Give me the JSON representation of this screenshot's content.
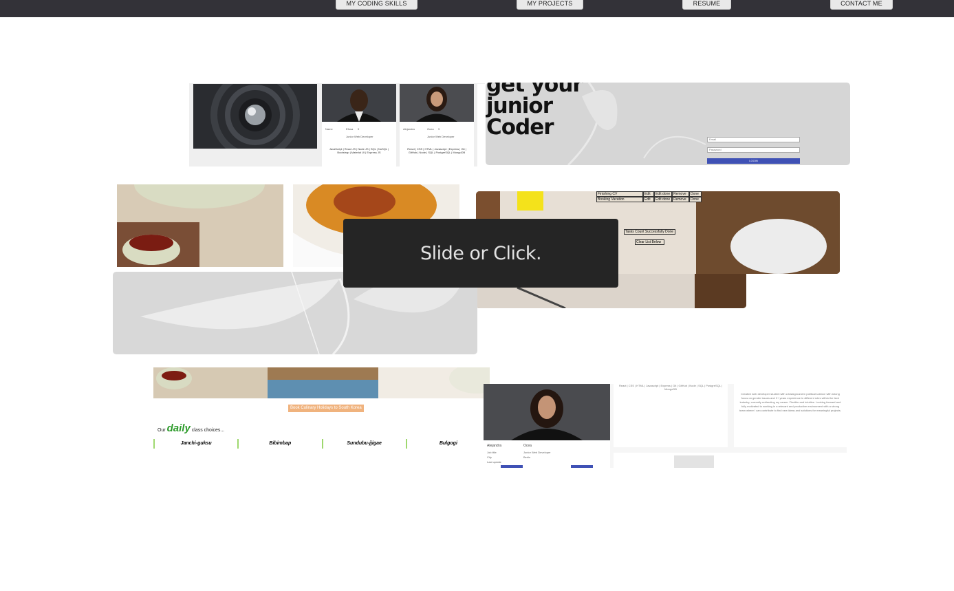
{
  "nav": {
    "items": [
      {
        "label": "MY CODING SKILLS"
      },
      {
        "label": "MY PROJECTS"
      },
      {
        "label": "RESUME"
      },
      {
        "label": "CONTACT ME"
      }
    ]
  },
  "overlay": {
    "text": "Slide or Click."
  },
  "tiles": {
    "dev_cards": {
      "cards": [
        {
          "name_left": "Name",
          "name_right": "Efosa",
          "title": "Junior Web Developer",
          "skills": "JavaScript | React JS | Node JS | SQL | NoSQL | Bootstrap | Material UI | Express JS"
        },
        {
          "name_left": "Alejandra",
          "name_right": "Ocea",
          "title": "Junior Web Developer",
          "skills": "React | CSS | HTML | Javascript | Express | Git | GitHub | Node | SQL | PostgreSQL | MongoDB"
        }
      ]
    },
    "junior_coder": {
      "headline": [
        "get your",
        "junior",
        "Coder"
      ],
      "email_placeholder": "Email",
      "password_placeholder": "Password",
      "login_label": "LOGIN"
    },
    "todo": {
      "rows": [
        {
          "task": "Finishing CV",
          "edit": "Edit",
          "edit_done": "Edit done",
          "remove": "Remove",
          "done": "Done"
        },
        {
          "task": "Booking Vacation",
          "edit": "Edit",
          "edit_done": "Edit done",
          "remove": "Remove",
          "done": "Done"
        }
      ],
      "count_button": "Tasks Count Successfully Done",
      "clear_button": "Clear List Below"
    },
    "culinary": {
      "banner": "Book Culinary Holidays to South Korea",
      "tagline_prefix": "Our",
      "tagline_daily": "daily",
      "tagline_suffix": "class choices...",
      "dishes": [
        "Janchi-guksu",
        "Bibimbap",
        "Sundubu-jjigae",
        "Bulgogi"
      ]
    },
    "profile": {
      "name_left": "Alejandra",
      "name_right": "Ocea",
      "job_label": "Job title",
      "job_value": "Junior Web Developer",
      "city_label": "City",
      "city_value": "Berlin",
      "updated_label": "Last update",
      "skills": "React | CSS | HTML | Javascript | Express | Git | GitHub | Node | SQL | PostgreSQL | MongoDB",
      "bio": "Creative web developer student with a background in political science with strong focus on gender issues and 2+ years experience in different roles within the tech industry, currently redirecting my career. Flexible and intuitive. Looking forward and fully motivated to working in a relevant and productive environment with a strong team where I can contribute to find new ideas and solutions for meaningful projects."
    }
  },
  "colors": {
    "topbar": "#333238",
    "overlay_bg": "#252525",
    "overlay_text": "#e3e3e3",
    "login_button": "#3f51b5",
    "banner": "#f0b37e",
    "daily_green": "#2d9b2b"
  }
}
